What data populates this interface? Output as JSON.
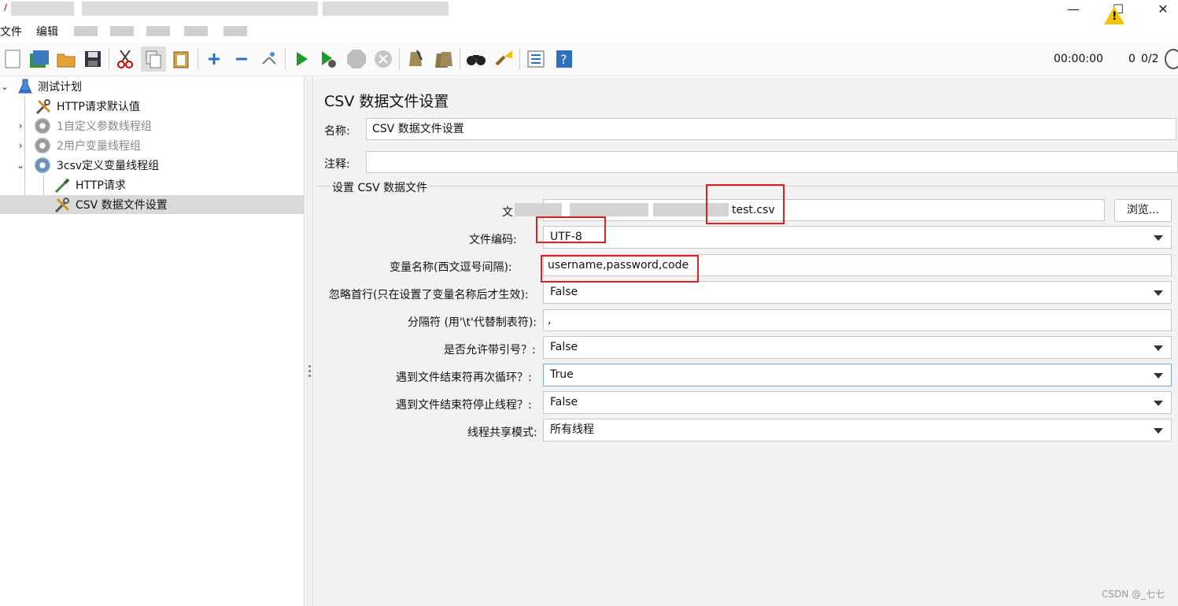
{
  "window": {
    "minimize_glyph": "—",
    "maximize_glyph": "☐",
    "close_glyph": "✕"
  },
  "menu": [
    "文件",
    "编辑"
  ],
  "toolbar": {
    "timer": "00:00:00",
    "warnings": "0",
    "threads": "0/2",
    "icons": [
      "new-icon",
      "templates-icon",
      "open-icon",
      "save-icon",
      "cut-icon",
      "copy-icon",
      "paste-icon",
      "expand-icon",
      "collapse-icon",
      "toggle-icon",
      "start-icon",
      "start-no-pause-icon",
      "stop-icon",
      "shutdown-icon",
      "clear-icon",
      "clear-all-icon",
      "search-icon",
      "reset-search-icon",
      "function-helper-icon",
      "help-icon"
    ]
  },
  "tree": {
    "items": [
      {
        "label": "测试计划",
        "icon": "flask-icon"
      },
      {
        "label": "HTTP请求默认值",
        "icon": "wrench-icon"
      },
      {
        "label": "1自定义参数线程组",
        "icon": "gear-icon",
        "disabled": true
      },
      {
        "label": "2用户变量线程组",
        "icon": "gear-icon",
        "disabled": true
      },
      {
        "label": "3csv定义变量线程组",
        "icon": "gear-icon"
      },
      {
        "label": "HTTP请求",
        "icon": "pipette-icon"
      },
      {
        "label": "CSV 数据文件设置",
        "icon": "wrench-icon",
        "selected": true
      }
    ]
  },
  "panel": {
    "title": "CSV 数据文件设置",
    "name_label": "名称:",
    "name_value": "CSV 数据文件设置",
    "comment_label": "注释:",
    "comment_value": "",
    "group_title": "设置 CSV 数据文件",
    "filename_label_visible": "文",
    "filename_value_visible": "test.csv",
    "browse_label": "浏览...",
    "encoding_label": "文件编码:",
    "encoding_value": "UTF-8",
    "varnames_label": "变量名称(西文逗号间隔):",
    "varnames_value": "username,password,code",
    "ignore_first_label": "忽略首行(只在设置了变量名称后才生效):",
    "ignore_first_value": "False",
    "delimiter_label": "分隔符 (用'\\t'代替制表符):",
    "delimiter_value": ",",
    "quoted_label": "是否允许带引号？:",
    "quoted_value": "False",
    "recycle_label": "遇到文件结束符再次循环？:",
    "recycle_value": "True",
    "stop_thread_label": "遇到文件结束符停止线程？:",
    "stop_thread_value": "False",
    "sharing_label": "线程共享模式:",
    "sharing_value": "所有线程"
  },
  "watermark": "CSDN @_七七"
}
